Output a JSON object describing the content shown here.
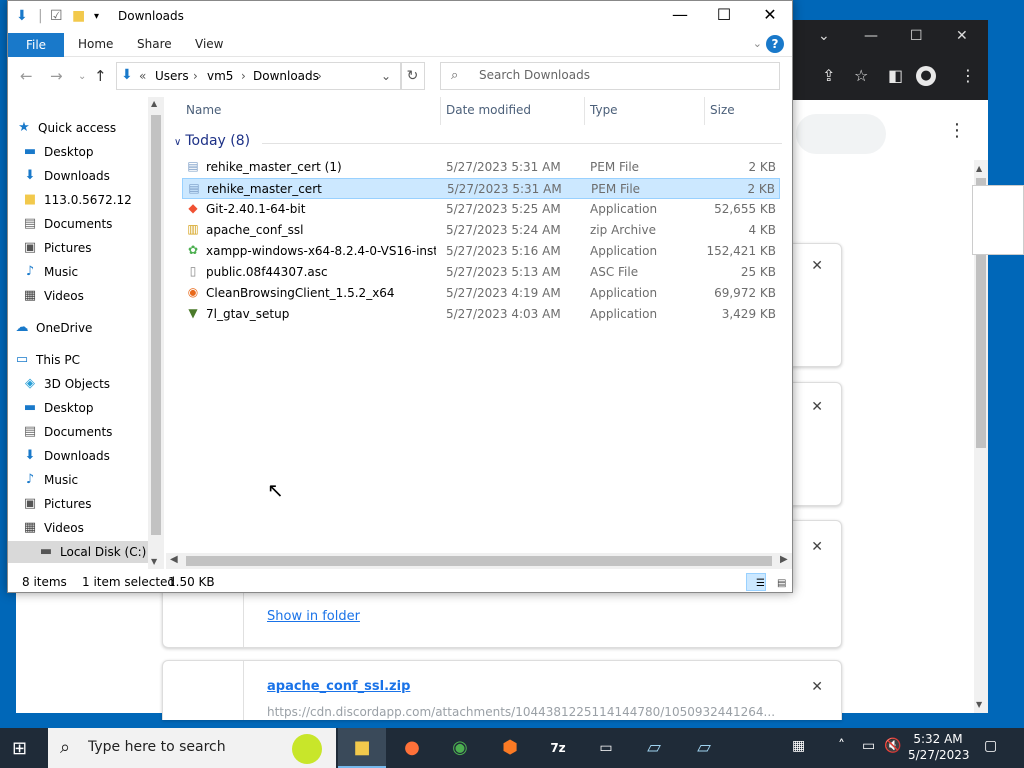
{
  "explorer": {
    "title": "Downloads",
    "ribbon": {
      "file": "File",
      "home": "Home",
      "share": "Share",
      "view": "View",
      "help": "?"
    },
    "address": {
      "prefix": "«",
      "crumbs": [
        "Users",
        "vm5",
        "Downloads"
      ]
    },
    "search_placeholder": "Search Downloads",
    "nav_pane": [
      {
        "label": "Quick access",
        "icon": "star-icon",
        "color": "#1979ca"
      },
      {
        "label": "Desktop",
        "icon": "desktop-icon",
        "pinned": true
      },
      {
        "label": "Downloads",
        "icon": "download-arrow-icon",
        "pinned": true
      },
      {
        "label": "113.0.5672.12",
        "icon": "folder-icon",
        "pinned": true
      },
      {
        "label": "Documents",
        "icon": "document-icon",
        "pinned": true
      },
      {
        "label": "Pictures",
        "icon": "picture-icon",
        "pinned": true
      },
      {
        "label": "Music",
        "icon": "music-icon"
      },
      {
        "label": "Videos",
        "icon": "video-icon"
      },
      {
        "label": "OneDrive",
        "icon": "cloud-icon"
      },
      {
        "label": "This PC",
        "icon": "computer-icon"
      },
      {
        "label": "3D Objects",
        "icon": "cube-icon"
      },
      {
        "label": "Desktop",
        "icon": "desktop-icon"
      },
      {
        "label": "Documents",
        "icon": "document-icon"
      },
      {
        "label": "Downloads",
        "icon": "download-arrow-icon"
      },
      {
        "label": "Music",
        "icon": "music-icon"
      },
      {
        "label": "Pictures",
        "icon": "picture-icon"
      },
      {
        "label": "Videos",
        "icon": "video-icon"
      },
      {
        "label": "Local Disk (C:)",
        "icon": "drive-icon"
      }
    ],
    "columns": {
      "name": "Name",
      "date": "Date modified",
      "type": "Type",
      "size": "Size"
    },
    "group": "Today (8)",
    "files": [
      {
        "name": "rehike_master_cert (1)",
        "date": "5/27/2023 5:31 AM",
        "type": "PEM File",
        "size": "2 KB",
        "icon": "certificate-icon"
      },
      {
        "name": "rehike_master_cert",
        "date": "5/27/2023 5:31 AM",
        "type": "PEM File",
        "size": "2 KB",
        "icon": "certificate-icon",
        "selected": true
      },
      {
        "name": "Git-2.40.1-64-bit",
        "date": "5/27/2023 5:25 AM",
        "type": "Application",
        "size": "52,655 KB",
        "icon": "git-icon"
      },
      {
        "name": "apache_conf_ssl",
        "date": "5/27/2023 5:24 AM",
        "type": "zip Archive",
        "size": "4 KB",
        "icon": "zip-icon"
      },
      {
        "name": "xampp-windows-x64-8.2.4-0-VS16-instal...",
        "date": "5/27/2023 5:16 AM",
        "type": "Application",
        "size": "152,421 KB",
        "icon": "xampp-icon"
      },
      {
        "name": "public.08f44307.asc",
        "date": "5/27/2023 5:13 AM",
        "type": "ASC File",
        "size": "25 KB",
        "icon": "file-icon"
      },
      {
        "name": "CleanBrowsingClient_1.5.2_x64",
        "date": "5/27/2023 4:19 AM",
        "type": "Application",
        "size": "69,972 KB",
        "icon": "cleanbrowsing-icon"
      },
      {
        "name": "7l_gtav_setup",
        "date": "5/27/2023 4:03 AM",
        "type": "Application",
        "size": "3,429 KB",
        "icon": "setup-icon"
      }
    ],
    "status": {
      "count": "8 items",
      "selected": "1 item selected",
      "size": "1.50 KB"
    }
  },
  "chrome": {
    "cards": [
      {
        "link": "",
        "url": ""
      },
      {
        "link": "",
        "url": ""
      },
      {
        "link": "Show in folder",
        "url": ""
      },
      {
        "link": "apache_conf_ssl.zip",
        "url": "https://cdn.discordapp.com/attachments/1044381225114144780/1050932441264..."
      }
    ]
  },
  "taskbar": {
    "search_placeholder": "Type here to search",
    "time": "5:32 AM",
    "date": "5/27/2023"
  }
}
